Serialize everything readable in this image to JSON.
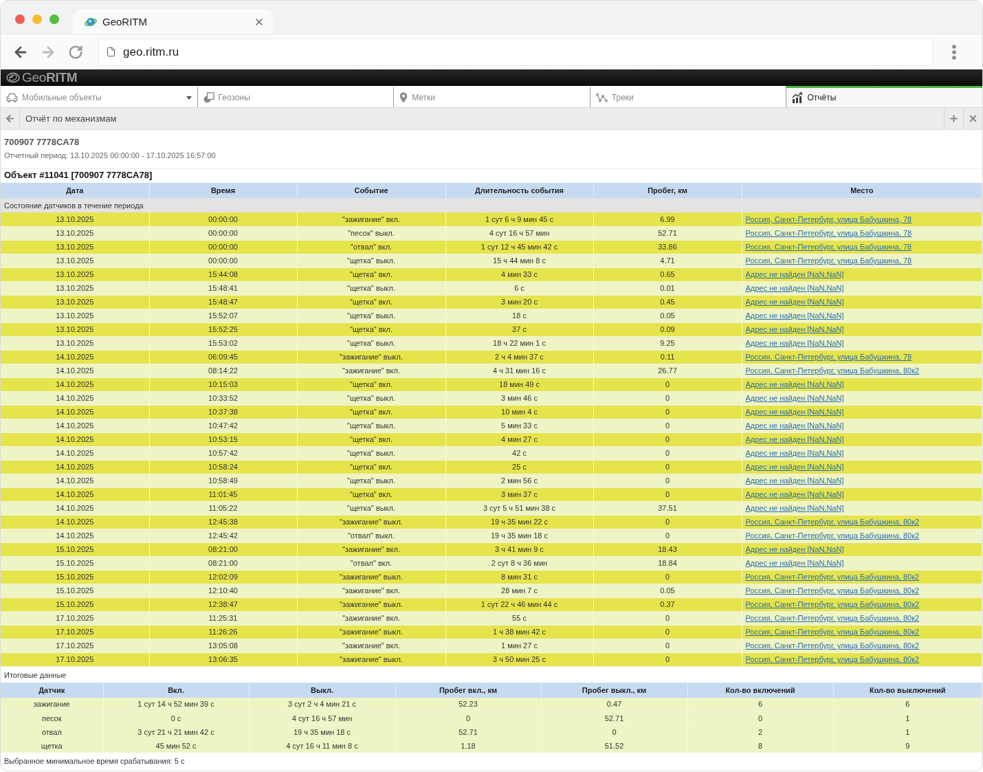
{
  "browser": {
    "tab_title": "GeoRITM",
    "url": "geo.ritm.ru"
  },
  "app": {
    "logo": "Geo**RITM**"
  },
  "tabs": [
    {
      "label": "Мобильные объекты",
      "selected": false,
      "dropdown": true
    },
    {
      "label": "Геозоны",
      "selected": false,
      "dropdown": false
    },
    {
      "label": "Метки",
      "selected": false,
      "dropdown": false
    },
    {
      "label": "Треки",
      "selected": false,
      "dropdown": false
    },
    {
      "label": "Отчёты",
      "selected": true,
      "dropdown": false
    }
  ],
  "toolbar": {
    "title": "Отчёт по механизмам"
  },
  "report": {
    "object": "700907 7778CA78",
    "period": "Отчетный период: 13.10.2025 00:00:00 - 17.10.2025 16:57:00",
    "section": "Объект #11041 [700907 7778CA78]"
  },
  "events": {
    "columns": [
      "Дата",
      "Время",
      "Событие",
      "Длительность события",
      "Пробег, км",
      "Место"
    ],
    "group": "Состояние датчиков в течение периода",
    "rows": [
      [
        "13.10.2025",
        "00:00:00",
        "\"зажигание\" вкл.",
        "1 сут 6 ч 9 мин 45 с",
        "6.99",
        "Россия, Санкт-Петербург, улица Бабушкина, 78"
      ],
      [
        "13.10.2025",
        "00:00:00",
        "\"песок\" выкл.",
        "4 сут 16 ч 57 мин",
        "52.71",
        "Россия, Санкт-Петербург, улица Бабушкина, 78"
      ],
      [
        "13.10.2025",
        "00:00:00",
        "\"отвал\" вкл.",
        "1 сут 12 ч 45 мин 42 с",
        "33.86",
        "Россия, Санкт-Петербург, улица Бабушкина, 78"
      ],
      [
        "13.10.2025",
        "00:00:00",
        "\"щетка\" выкл.",
        "15 ч 44 мин 8 с",
        "4.71",
        "Россия, Санкт-Петербург, улица Бабушкина, 78"
      ],
      [
        "13.10.2025",
        "15:44:08",
        "\"щетка\" вкл.",
        "4 мин 33 с",
        "0.65",
        "Адрес не найден [NaN,NaN]"
      ],
      [
        "13.10.2025",
        "15:48:41",
        "\"щетка\" выкл.",
        "6 с",
        "0.01",
        "Адрес не найден [NaN,NaN]"
      ],
      [
        "13.10.2025",
        "15:48:47",
        "\"щетка\" вкл.",
        "3 мин 20 с",
        "0.45",
        "Адрес не найден [NaN,NaN]"
      ],
      [
        "13.10.2025",
        "15:52:07",
        "\"щетка\" выкл.",
        "18 с",
        "0.05",
        "Адрес не найден [NaN,NaN]"
      ],
      [
        "13.10.2025",
        "15:52:25",
        "\"щетка\" вкл.",
        "37 с",
        "0.09",
        "Адрес не найден [NaN,NaN]"
      ],
      [
        "13.10.2025",
        "15:53:02",
        "\"щетка\" выкл.",
        "18 ч 22 мин 1 с",
        "9.25",
        "Адрес не найден [NaN,NaN]"
      ],
      [
        "14.10.2025",
        "06:09:45",
        "\"зажигание\" выкл.",
        "2 ч 4 мин 37 с",
        "0.11",
        "Россия, Санкт-Петербург, улица Бабушкина, 78"
      ],
      [
        "14.10.2025",
        "08:14:22",
        "\"зажигание\" вкл.",
        "4 ч 31 мин 16 с",
        "26.77",
        "Россия, Санкт-Петербург, улица Бабушкина, 80к2"
      ],
      [
        "14.10.2025",
        "10:15:03",
        "\"щетка\" вкл.",
        "18 мин 49 с",
        "0",
        "Адрес не найден [NaN,NaN]"
      ],
      [
        "14.10.2025",
        "10:33:52",
        "\"щетка\" выкл.",
        "3 мин 46 с",
        "0",
        "Адрес не найден [NaN,NaN]"
      ],
      [
        "14.10.2025",
        "10:37:38",
        "\"щетка\" вкл.",
        "10 мин 4 с",
        "0",
        "Адрес не найден [NaN,NaN]"
      ],
      [
        "14.10.2025",
        "10:47:42",
        "\"щетка\" выкл.",
        "5 мин 33 с",
        "0",
        "Адрес не найден [NaN,NaN]"
      ],
      [
        "14.10.2025",
        "10:53:15",
        "\"щетка\" вкл.",
        "4 мин 27 с",
        "0",
        "Адрес не найден [NaN,NaN]"
      ],
      [
        "14.10.2025",
        "10:57:42",
        "\"щетка\" выкл.",
        "42 с",
        "0",
        "Адрес не найден [NaN,NaN]"
      ],
      [
        "14.10.2025",
        "10:58:24",
        "\"щетка\" вкл.",
        "25 с",
        "0",
        "Адрес не найден [NaN,NaN]"
      ],
      [
        "14.10.2025",
        "10:58:49",
        "\"щетка\" выкл.",
        "2 мин 56 с",
        "0",
        "Адрес не найден [NaN,NaN]"
      ],
      [
        "14.10.2025",
        "11:01:45",
        "\"щетка\" вкл.",
        "3 мин 37 с",
        "0",
        "Адрес не найден [NaN,NaN]"
      ],
      [
        "14.10.2025",
        "11:05:22",
        "\"щетка\" выкл.",
        "3 сут 5 ч 51 мин 38 с",
        "37.51",
        "Адрес не найден [NaN,NaN]"
      ],
      [
        "14.10.2025",
        "12:45:38",
        "\"зажигание\" выкл.",
        "19 ч 35 мин 22 с",
        "0",
        "Россия, Санкт-Петербург, улица Бабушкина, 80к2"
      ],
      [
        "14.10.2025",
        "12:45:42",
        "\"отвал\" выкл.",
        "19 ч 35 мин 18 с",
        "0",
        "Россия, Санкт-Петербург, улица Бабушкина, 80к2"
      ],
      [
        "15.10.2025",
        "08:21:00",
        "\"зажигание\" вкл.",
        "3 ч 41 мин 9 с",
        "18.43",
        "Адрес не найден [NaN,NaN]"
      ],
      [
        "15.10.2025",
        "08:21:00",
        "\"отвал\" вкл.",
        "2 сут 8 ч 36 мин",
        "18.84",
        "Адрес не найден [NaN,NaN]"
      ],
      [
        "15.10.2025",
        "12:02:09",
        "\"зажигание\" выкл.",
        "8 мин 31 с",
        "0",
        "Россия, Санкт-Петербург, улица Бабушкина, 80к2"
      ],
      [
        "15.10.2025",
        "12:10:40",
        "\"зажигание\" вкл.",
        "28 мин 7 с",
        "0.05",
        "Россия, Санкт-Петербург, улица Бабушкина, 80к2"
      ],
      [
        "15.10.2025",
        "12:38:47",
        "\"зажигание\" выкл.",
        "1 сут 22 ч 46 мин 44 с",
        "0.37",
        "Россия, Санкт-Петербург, улица Бабушкина, 80к2"
      ],
      [
        "17.10.2025",
        "11:25:31",
        "\"зажигание\" вкл.",
        "55 с",
        "0",
        "Россия, Санкт-Петербург, улица Бабушкина, 80к2"
      ],
      [
        "17.10.2025",
        "11:26:26",
        "\"зажигание\" выкл.",
        "1 ч 38 мин 42 с",
        "0",
        "Россия, Санкт-Петербург, улица Бабушкина, 80к2"
      ],
      [
        "17.10.2025",
        "13:05:08",
        "\"зажигание\" вкл.",
        "1 мин 27 с",
        "0",
        "Россия, Санкт-Петербург, улица Бабушкина, 80к2"
      ],
      [
        "17.10.2025",
        "13:06:35",
        "\"зажигание\" выкл.",
        "3 ч 50 мин 25 с",
        "0",
        "Россия, Санкт-Петербург, улица Бабушкина, 80к2"
      ]
    ]
  },
  "summary": {
    "title": "Итоговые данные",
    "columns": [
      "Датчик",
      "Вкл.",
      "Выкл.",
      "Пробег вкл., км",
      "Пробег выкл., км",
      "Кол-во включений",
      "Кол-во выключений"
    ],
    "rows": [
      [
        "зажигание",
        "1 сут 14 ч 52 мин 39 с",
        "3 сут 2 ч 4 мин 21 с",
        "52.23",
        "0.47",
        "6",
        "6"
      ],
      [
        "песок",
        "0 с",
        "4 сут 16 ч 57 мин",
        "0",
        "52.71",
        "0",
        "1"
      ],
      [
        "отвал",
        "3 сут 21 ч 21 мин 42 с",
        "19 ч 35 мин 18 с",
        "52.71",
        "0",
        "2",
        "1"
      ],
      [
        "щетка",
        "45 мин 52 с",
        "4 сут 16 ч 11 мин 8 с",
        "1.18",
        "51.52",
        "8",
        "9"
      ]
    ]
  },
  "footnote": "Выбранное минимальное время срабатывания: 5 с"
}
